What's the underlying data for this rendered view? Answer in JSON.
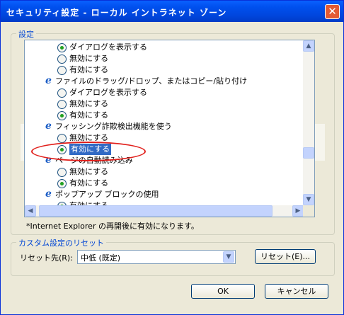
{
  "window": {
    "title": "セキュリティ設定 - ローカル イントラネット ゾーン",
    "close_glyph": "✕"
  },
  "settings_group": {
    "legend": "設定"
  },
  "list": {
    "rows": [
      {
        "kind": "option",
        "label": "ダイアログを表示する",
        "checked": true
      },
      {
        "kind": "option",
        "label": "無効にする",
        "checked": false
      },
      {
        "kind": "option",
        "label": "有効にする",
        "checked": false
      },
      {
        "kind": "header",
        "label": "ファイルのドラッグ/ドロップ、またはコピー/貼り付け",
        "icon": "ie-icon"
      },
      {
        "kind": "option",
        "label": "ダイアログを表示する",
        "checked": false
      },
      {
        "kind": "option",
        "label": "無効にする",
        "checked": false
      },
      {
        "kind": "option",
        "label": "有効にする",
        "checked": true
      },
      {
        "kind": "header",
        "label": "フィッシング詐欺検出機能を使う",
        "icon": "ie-icon"
      },
      {
        "kind": "option",
        "label": "無効にする",
        "checked": false
      },
      {
        "kind": "option",
        "label": "有効にする",
        "checked": true,
        "selected": true
      },
      {
        "kind": "header",
        "label": "ページの自動読み込み",
        "icon": "ie-icon"
      },
      {
        "kind": "option",
        "label": "無効にする",
        "checked": false
      },
      {
        "kind": "option",
        "label": "有効にする",
        "checked": true
      },
      {
        "kind": "header",
        "label": "ポップアップ ブロックの使用",
        "icon": "ie-icon"
      },
      {
        "kind": "option",
        "label": "有効にする",
        "checked": true
      }
    ]
  },
  "note": "*Internet Explorer の再開後に有効になります。",
  "reset_group": {
    "legend": "カスタム設定のリセット",
    "label": "リセット先(R):",
    "select_value": "中低 (既定)",
    "reset_button": "リセット(E)..."
  },
  "footer": {
    "ok": "OK",
    "cancel": "キャンセル"
  },
  "colors": {
    "titlebar": "#0054e3",
    "selection": "#316ac5",
    "annotation": "#e1201c"
  }
}
